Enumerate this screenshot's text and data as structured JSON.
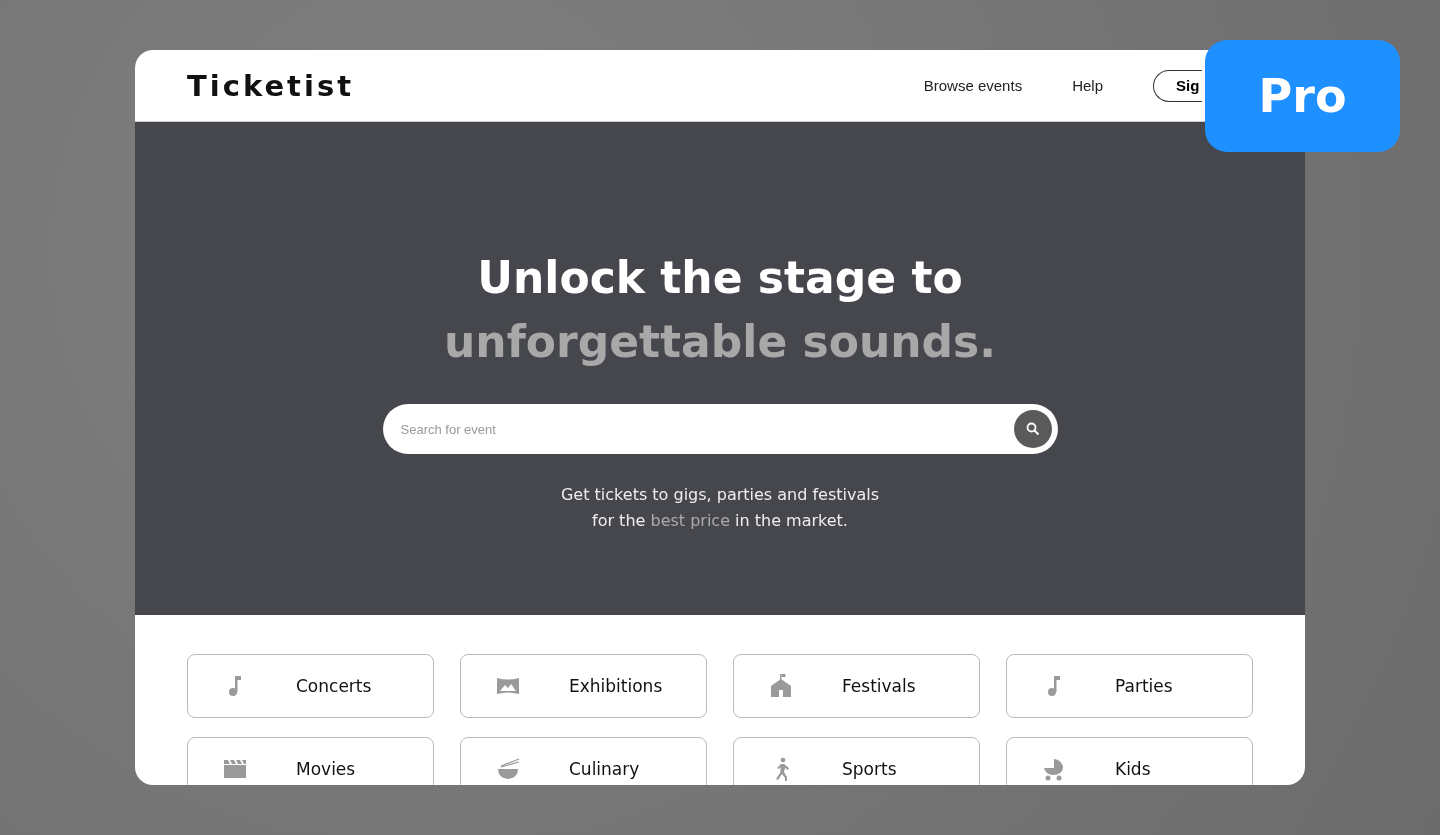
{
  "header": {
    "logo": "Ticketist",
    "nav": [
      "Browse events",
      "Help"
    ],
    "sign_button": "Sig"
  },
  "badge": "Pro",
  "hero": {
    "title_line_1": "Unlock the stage to",
    "title_line_2": "unforgettable sounds.",
    "search": {
      "placeholder": "Search for event"
    },
    "subtitle": [
      {
        "text": "Get tickets to gigs, parties and festivals for the ",
        "highlight": false
      },
      {
        "text": "best price",
        "highlight": true
      },
      {
        "text": " in the market.",
        "highlight": false
      }
    ]
  },
  "categories": [
    {
      "label": "Concerts",
      "kind": "note"
    },
    {
      "label": "Exhibitions",
      "kind": "gallery"
    },
    {
      "label": "Festivals",
      "kind": "tent"
    },
    {
      "label": "Parties",
      "kind": "note"
    },
    {
      "label": "Movies",
      "kind": "clapper"
    },
    {
      "label": "Culinary",
      "kind": "bowl"
    },
    {
      "label": "Sports",
      "kind": "runner"
    },
    {
      "label": "Kids",
      "kind": "stroller"
    }
  ]
}
